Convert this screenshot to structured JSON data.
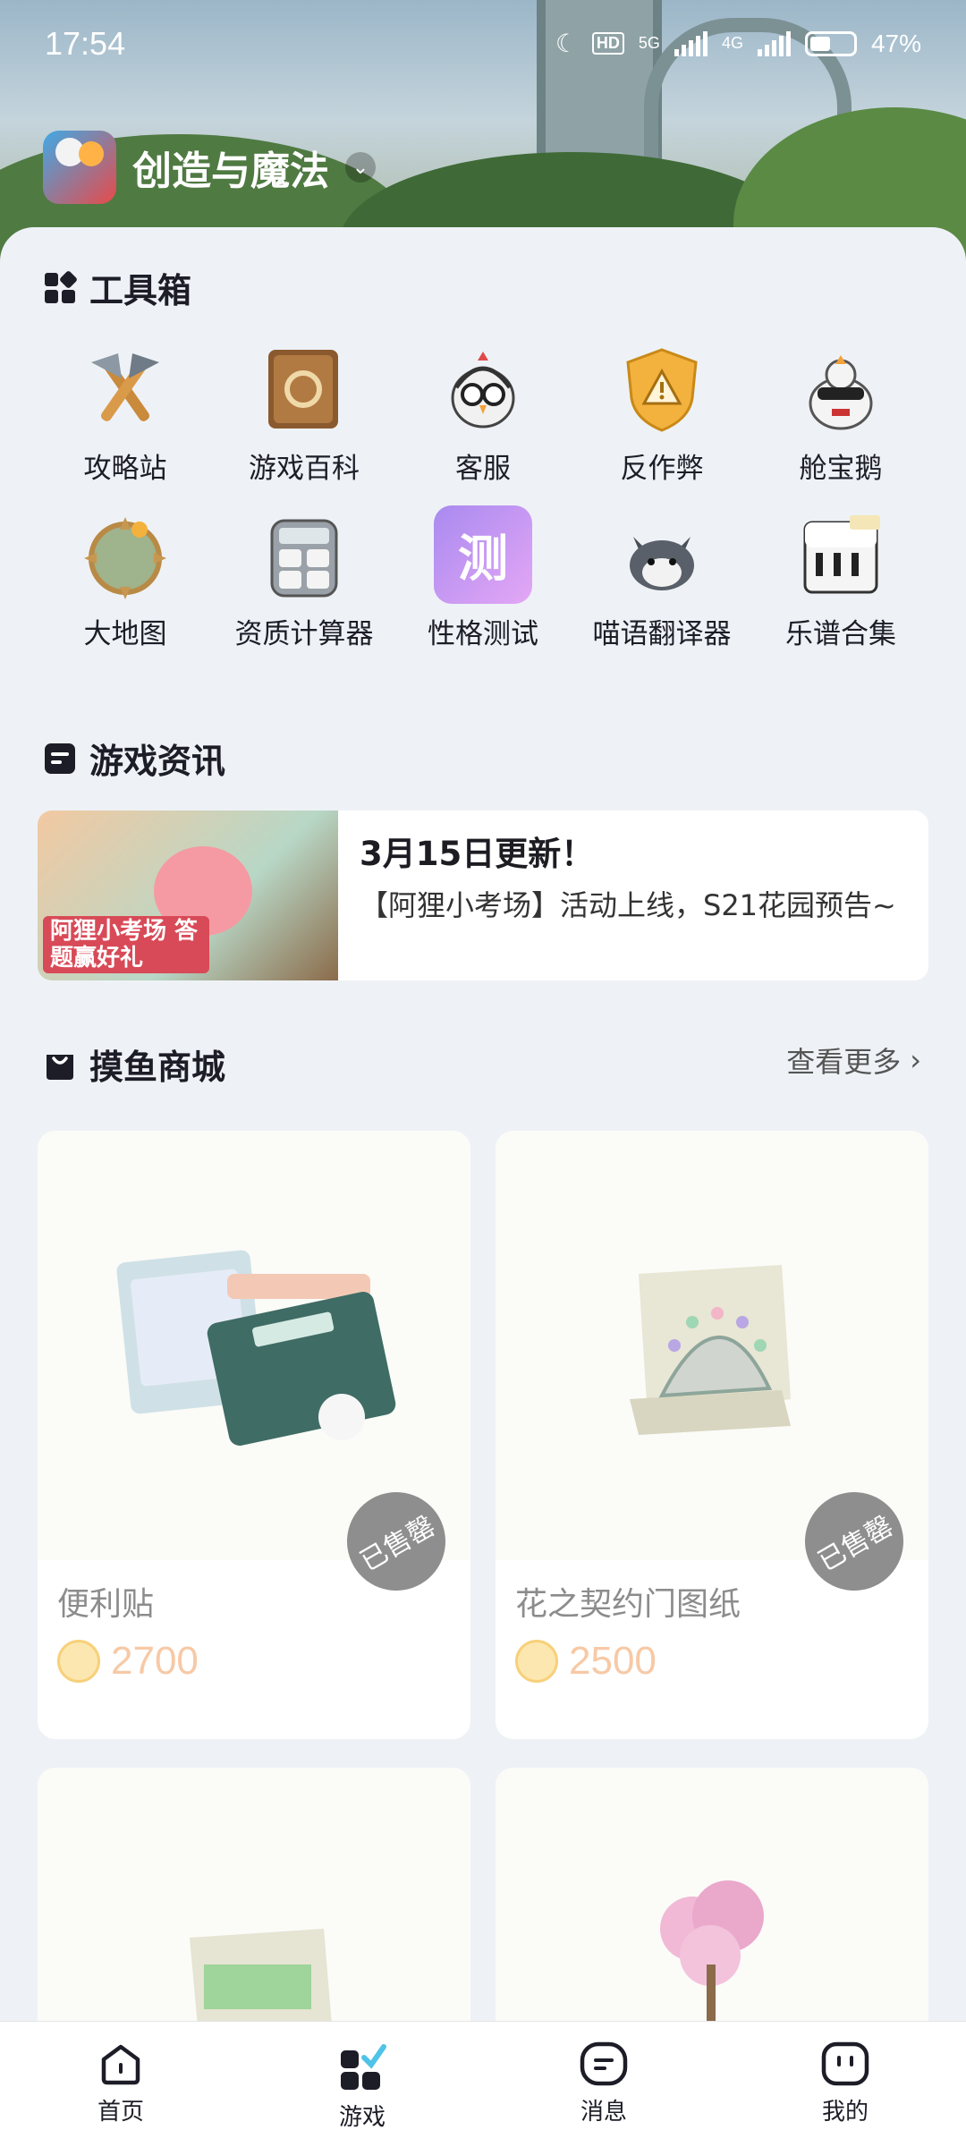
{
  "status_bar": {
    "time": "17:54",
    "battery": "47%",
    "net1": "5G",
    "net2": "4G",
    "hd": "HD"
  },
  "app": {
    "name": "创造与魔法"
  },
  "toolbox": {
    "title": "工具箱",
    "items": [
      {
        "label": "攻略站",
        "icon": "axe-icon"
      },
      {
        "label": "游戏百科",
        "icon": "book-icon"
      },
      {
        "label": "客服",
        "icon": "headset-bird-icon"
      },
      {
        "label": "反作弊",
        "icon": "warning-shield-icon"
      },
      {
        "label": "舱宝鹅",
        "icon": "goose-icon"
      },
      {
        "label": "大地图",
        "icon": "map-compass-icon"
      },
      {
        "label": "资质计算器",
        "icon": "calculator-icon"
      },
      {
        "label": "性格测试",
        "icon": "test-icon"
      },
      {
        "label": "喵语翻译器",
        "icon": "cat-icon"
      },
      {
        "label": "乐谱合集",
        "icon": "piano-icon"
      }
    ]
  },
  "news": {
    "title": "游戏资讯",
    "item": {
      "headline": "3月15日更新！",
      "summary": "【阿狸小考场】活动上线，S21花园预告~",
      "thumb_caption": "阿狸小考场 答题赢好礼"
    }
  },
  "shop": {
    "title": "摸鱼商城",
    "more_label": "查看更多",
    "items": [
      {
        "name": "便利贴",
        "price": "2700",
        "status": "已售罄"
      },
      {
        "name": "花之契约门图纸",
        "price": "2500",
        "status": "已售罄"
      }
    ]
  },
  "tabbar": {
    "items": [
      {
        "label": "首页"
      },
      {
        "label": "游戏"
      },
      {
        "label": "消息"
      },
      {
        "label": "我的"
      }
    ]
  }
}
